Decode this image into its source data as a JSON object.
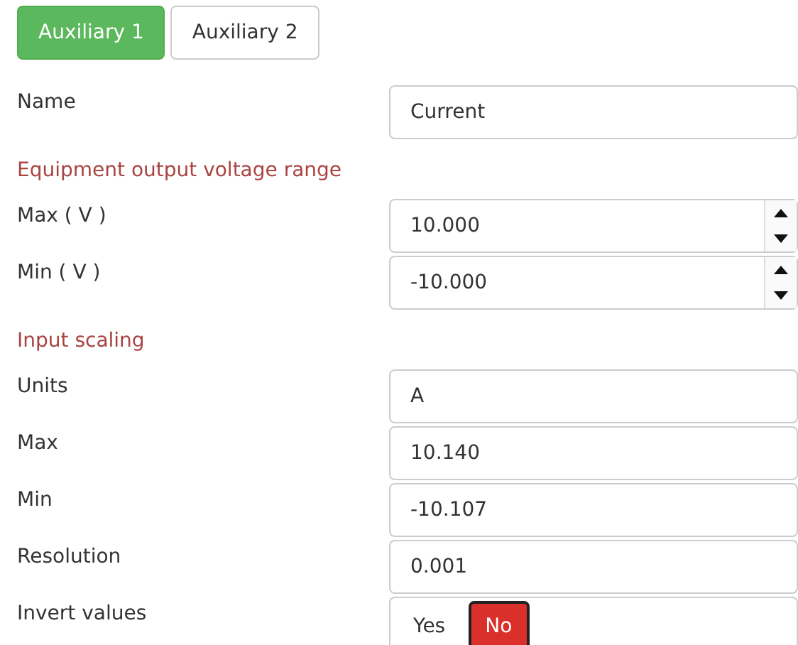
{
  "tabs": [
    {
      "label": "Auxiliary 1",
      "selected": true
    },
    {
      "label": "Auxiliary 2",
      "selected": false
    }
  ],
  "rows": [
    {
      "kind": "text",
      "label": "Name",
      "value": "Current"
    },
    {
      "kind": "heading",
      "label": "Equipment output voltage range"
    },
    {
      "kind": "spin",
      "label": "Max ( V )",
      "value": "10.000"
    },
    {
      "kind": "spin",
      "label": "Min ( V )",
      "value": "-10.000"
    },
    {
      "kind": "heading",
      "label": "Input scaling"
    },
    {
      "kind": "text",
      "label": "Units",
      "value": "A"
    },
    {
      "kind": "text",
      "label": "Max",
      "value": "10.140"
    },
    {
      "kind": "text",
      "label": "Min",
      "value": "-10.107"
    },
    {
      "kind": "text",
      "label": "Resolution",
      "value": "0.001"
    },
    {
      "kind": "toggle",
      "label": "Invert values",
      "options": [
        {
          "label": "Yes",
          "selected": false
        },
        {
          "label": "No",
          "selected": true
        }
      ]
    }
  ]
}
